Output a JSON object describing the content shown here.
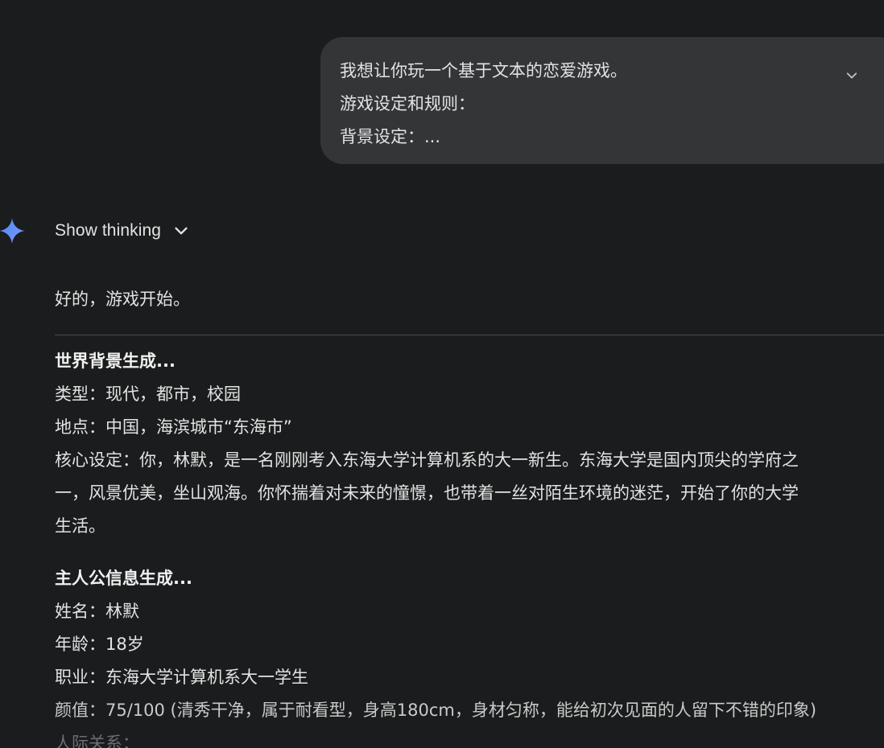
{
  "user_prompt": {
    "lines": [
      "我想让你玩一个基于文本的恋爱游戏。",
      "游戏设定和规则：",
      "背景设定：..."
    ],
    "expand_icon": "chevron-down-icon"
  },
  "model": {
    "avatar_icon": "gemini-sparkle-icon",
    "avatar_colors": [
      "#4f86f7",
      "#7a9cf5"
    ],
    "show_thinking_label": "Show thinking",
    "show_thinking_icon": "chevron-down-icon"
  },
  "response": {
    "intro": "好的，游戏开始。",
    "world": {
      "heading": "世界背景生成...",
      "lines": [
        "类型：现代，都市，校园",
        "地点：中国，海滨城市“东海市”",
        "核心设定：你，林默，是一名刚刚考入东海大学计算机系的大一新生。东海大学是国内顶尖的学府之",
        "一，风景优美，坐山观海。你怀揣着对未来的憧憬，也带着一丝对陌生环境的迷茫，开始了你的大学",
        "生活。"
      ]
    },
    "protagonist": {
      "heading": "主人公信息生成...",
      "lines": [
        "姓名：林默",
        "年龄：18岁",
        "职业：东海大学计算机系大一学生",
        "颜值：75/100 (清秀干净，属于耐看型，身高180cm，身材匀称，能给初次见面的人留下不错的印象)",
        "人际关系："
      ]
    }
  }
}
